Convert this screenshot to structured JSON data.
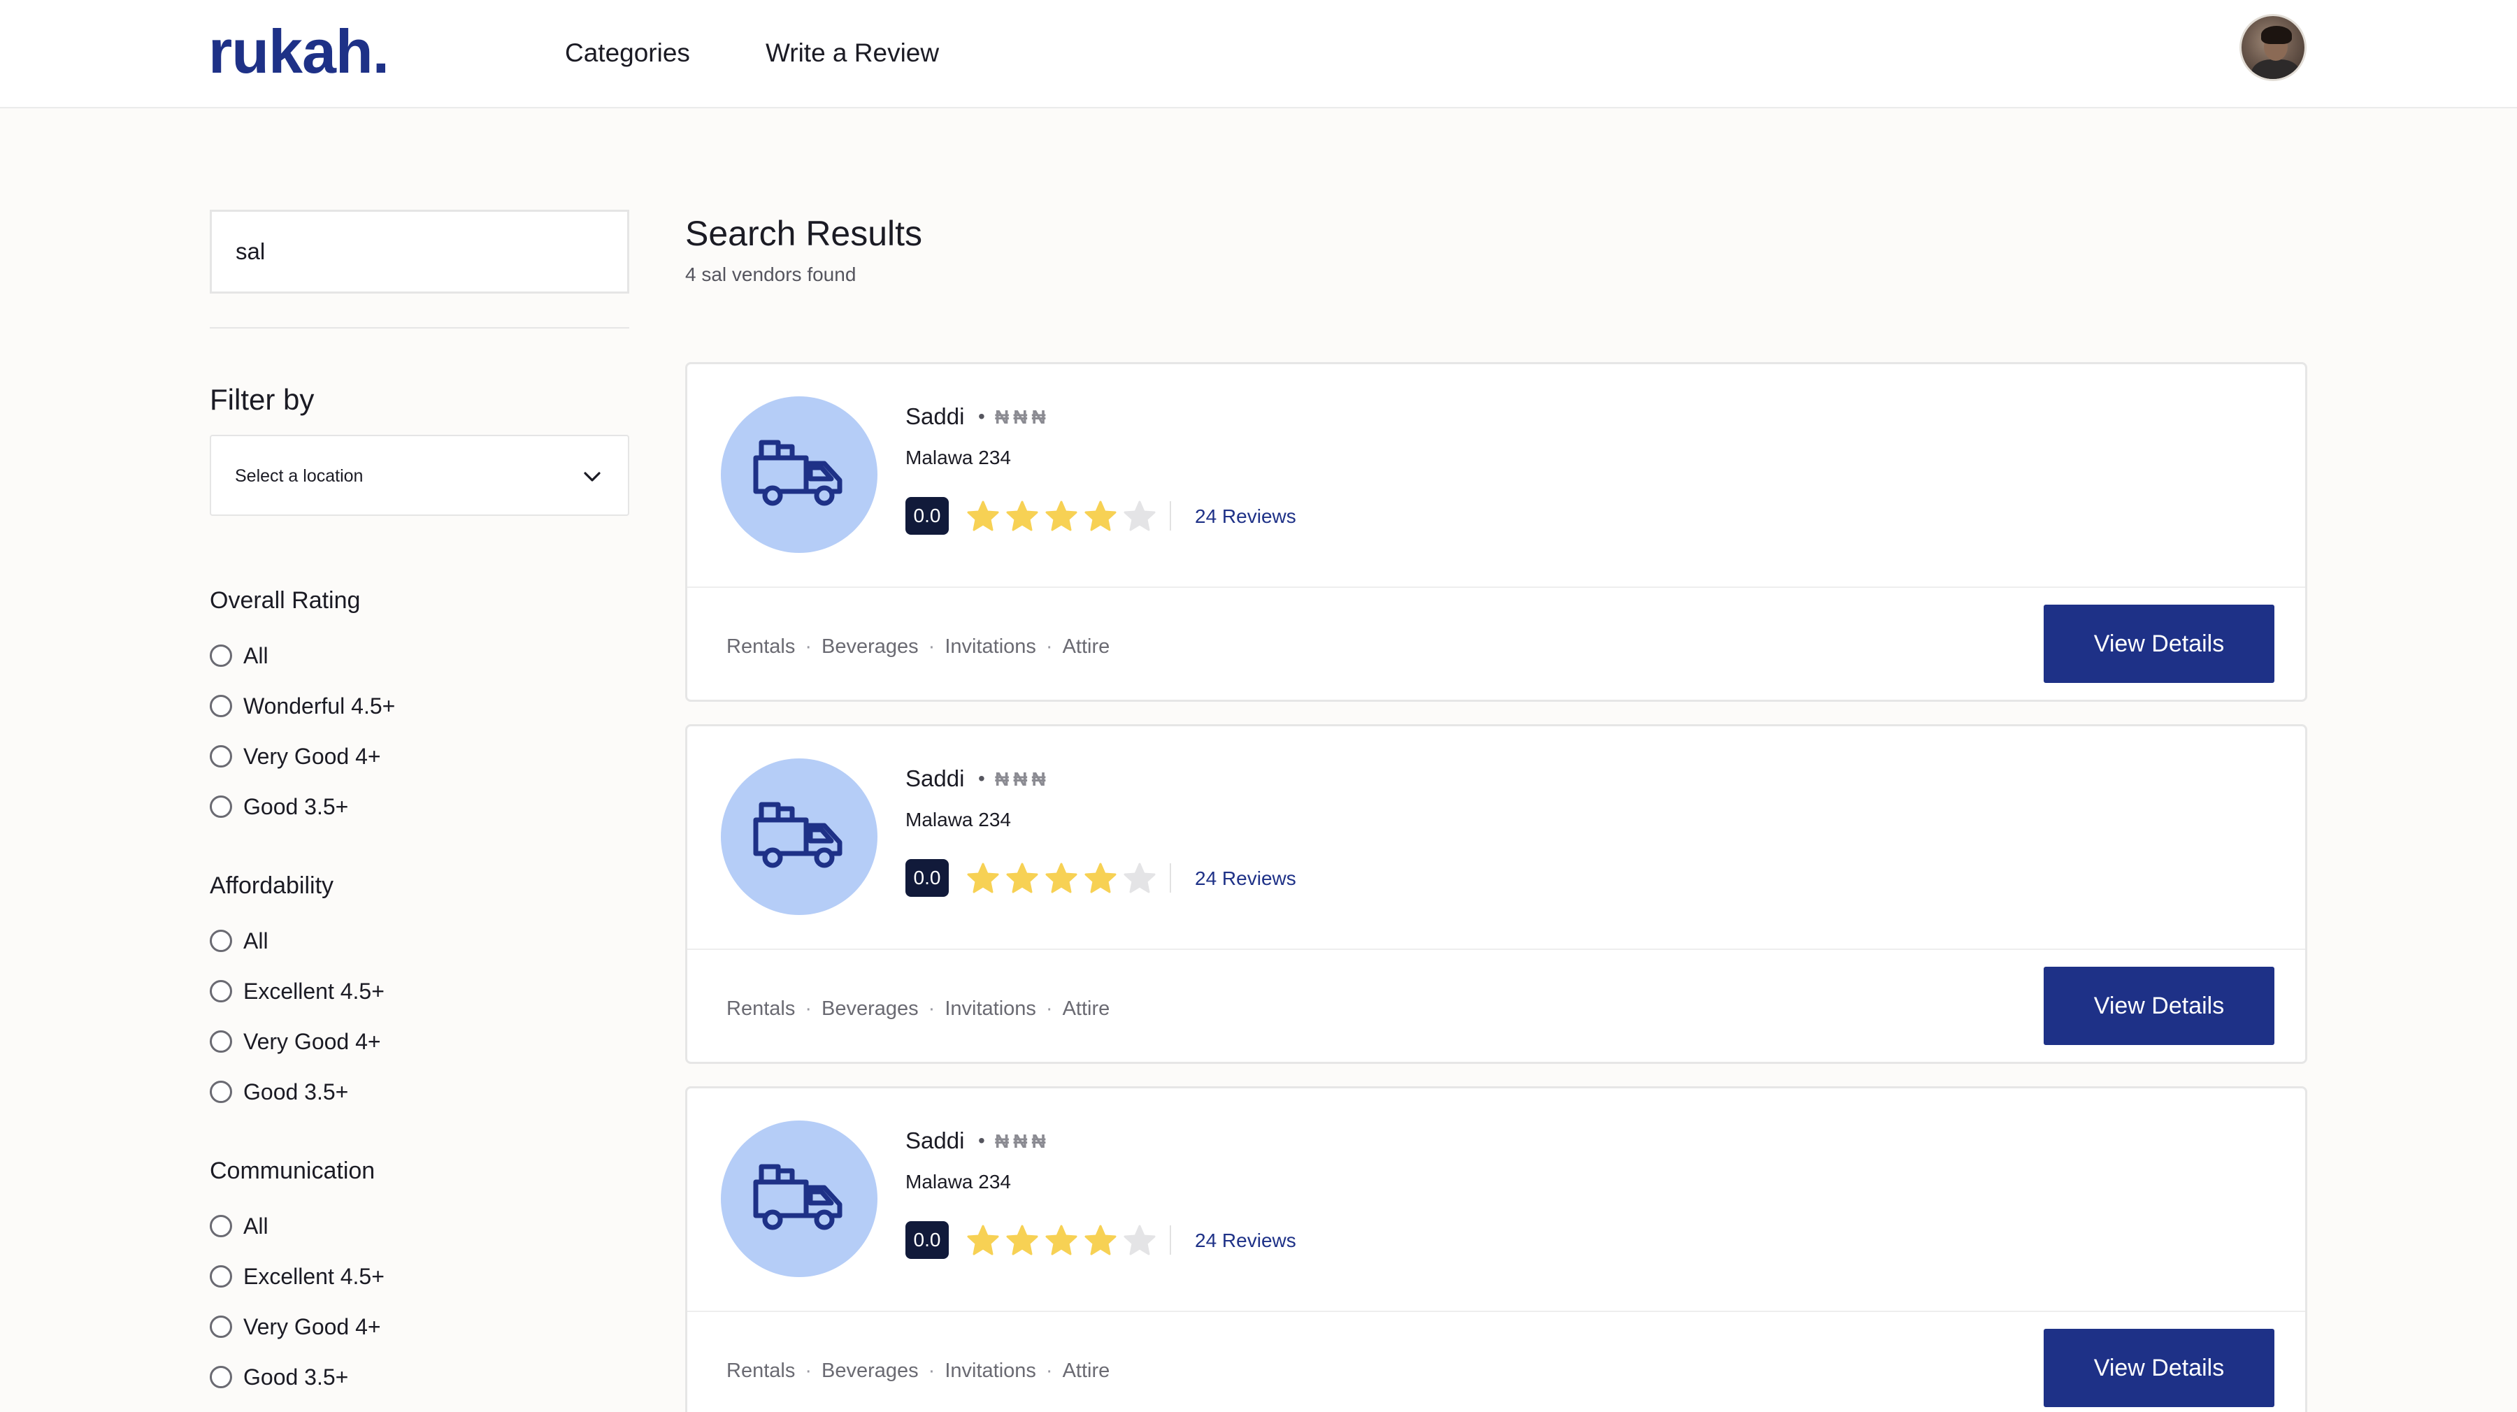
{
  "brand": {
    "logo_text": "rukah."
  },
  "nav": {
    "categories": "Categories",
    "write_review": "Write a Review"
  },
  "search": {
    "value": "sal"
  },
  "filters": {
    "title": "Filter by",
    "location_placeholder": "Select a location",
    "groups": [
      {
        "title": "Overall Rating",
        "options": [
          "All",
          "Wonderful 4.5+",
          "Very Good 4+",
          "Good 3.5+"
        ]
      },
      {
        "title": "Affordability",
        "options": [
          "All",
          "Excellent 4.5+",
          "Very Good 4+",
          "Good 3.5+"
        ]
      },
      {
        "title": "Communication",
        "options": [
          "All",
          "Excellent 4.5+",
          "Very Good 4+",
          "Good 3.5+"
        ]
      }
    ]
  },
  "results": {
    "title": "Search Results",
    "subtitle": "4 sal vendors found",
    "vendors": [
      {
        "name": "Saddi",
        "price": "₦₦₦",
        "address": "Malawa 234",
        "score": "0.0",
        "stars_filled": 4,
        "stars_total": 5,
        "reviews": "24 Reviews",
        "tags": [
          "Rentals",
          "Beverages",
          "Invitations",
          "Attire"
        ],
        "button": "View Details"
      },
      {
        "name": "Saddi",
        "price": "₦₦₦",
        "address": "Malawa 234",
        "score": "0.0",
        "stars_filled": 4,
        "stars_total": 5,
        "reviews": "24 Reviews",
        "tags": [
          "Rentals",
          "Beverages",
          "Invitations",
          "Attire"
        ],
        "button": "View Details"
      },
      {
        "name": "Saddi",
        "price": "₦₦₦",
        "address": "Malawa 234",
        "score": "0.0",
        "stars_filled": 4,
        "stars_total": 5,
        "reviews": "24 Reviews",
        "tags": [
          "Rentals",
          "Beverages",
          "Invitations",
          "Attire"
        ],
        "button": "View Details"
      }
    ]
  },
  "colors": {
    "brand": "#1e3187",
    "star_filled": "#f7d154",
    "star_empty": "#e4e4e6",
    "logo_circle": "#b5cdf7"
  },
  "icons": {
    "vendor": "truck-icon",
    "select": "chevron-down-icon",
    "rating": "star-icon"
  }
}
